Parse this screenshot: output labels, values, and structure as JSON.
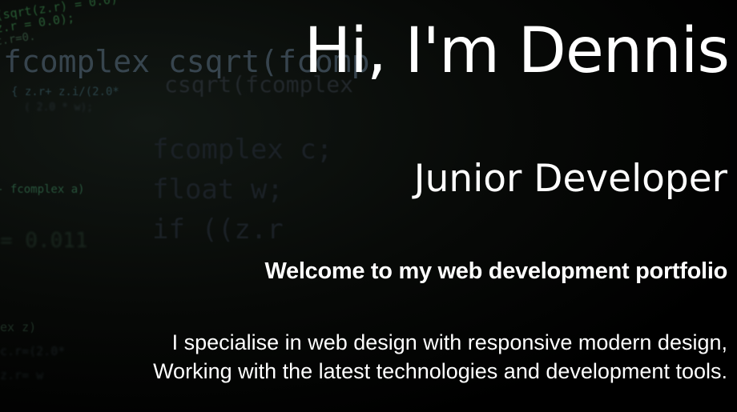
{
  "hero": {
    "title": "Hi, I'm Dennis",
    "role": "Junior Developer",
    "welcome": "Welcome to my web development portfolio",
    "description_lines": [
      "I specialise in web design with responsive modern design,",
      "Working with the latest technologies and development tools."
    ]
  },
  "background_code": {
    "lines": [
      "(sqrt(z.r) = 0.0)",
      "z.r = 0.0);",
      "c.r=0.",
      "fcomplex csqrt(fcomplex",
      "csqrt(fcomplex",
      "{ z.r+ z.i/(2.0*",
      "( 2.0 * w);",
      "fcomplex c;",
      "float w;",
      "if ((z.r",
      "- fcomplex a)",
      "= 0.011",
      "ex z)",
      "c.r=(2.0*",
      "z.r= w"
    ]
  },
  "colors": {
    "background": "#000000",
    "text": "#ffffff",
    "code_green": "#48a85d",
    "code_gray": "#3f4e5a"
  }
}
